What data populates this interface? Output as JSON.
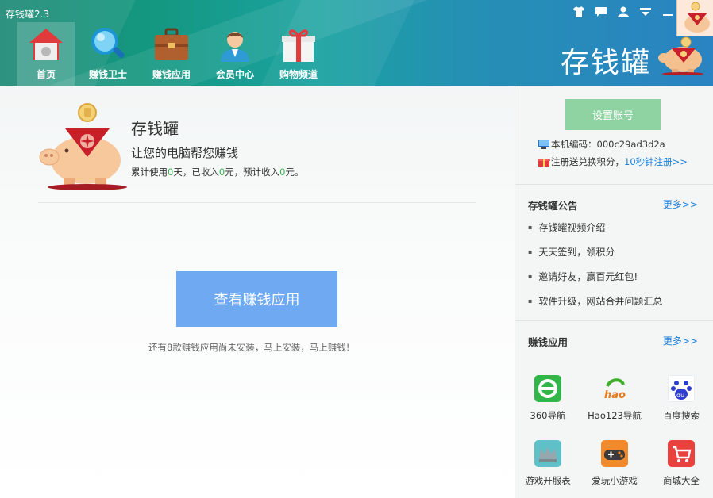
{
  "app": {
    "title": "存钱罐2.3"
  },
  "nav": [
    {
      "label": "首页",
      "icon": "home-icon"
    },
    {
      "label": "赚钱卫士",
      "icon": "magnifier-icon"
    },
    {
      "label": "赚钱应用",
      "icon": "briefcase-icon"
    },
    {
      "label": "会员中心",
      "icon": "member-avatar-icon"
    },
    {
      "label": "购物频道",
      "icon": "gift-icon"
    }
  ],
  "brand": {
    "text": "存钱罐"
  },
  "main": {
    "title": "存钱罐",
    "subtitle": "让您的电脑帮您赚钱",
    "stats": {
      "p1": "累计使用",
      "days": "0",
      "p2": "天，已收入",
      "income": "0",
      "p3": "元，预计收入",
      "expected": "0",
      "p4": "元。"
    },
    "cta_label": "查看赚钱应用",
    "cta_note": "还有8款赚钱应用尚未安装，马上安装，马上赚钱!"
  },
  "sidebar": {
    "set_account_label": "设置账号",
    "machine_code_label": "本机编码：",
    "machine_code": "000c29ad3d2a",
    "register_text": "注册送兑换积分，",
    "register_link": "10秒钟注册>>",
    "notice": {
      "title": "存钱罐公告",
      "more": "更多>>",
      "items": [
        "存钱罐视频介绍",
        "天天签到，领积分",
        "邀请好友，赢百元红包!",
        "软件升级，网站合并问题汇总"
      ]
    },
    "apps": {
      "title": "赚钱应用",
      "more": "更多>>",
      "items": [
        {
          "label": "360导航",
          "icon": "ie-360-icon"
        },
        {
          "label": "Hao123导航",
          "icon": "hao123-icon"
        },
        {
          "label": "百度搜索",
          "icon": "baidu-paw-icon"
        },
        {
          "label": "游戏开服表",
          "icon": "crown-icon"
        },
        {
          "label": "爱玩小游戏",
          "icon": "gamepad-icon"
        },
        {
          "label": "商城大全",
          "icon": "shopping-cart-icon"
        }
      ]
    }
  },
  "colors": {
    "accent_green": "#2fb54a",
    "link_blue": "#1d7fd6",
    "cta_blue": "#6fa9f2",
    "account_green": "#8fd3a2"
  }
}
